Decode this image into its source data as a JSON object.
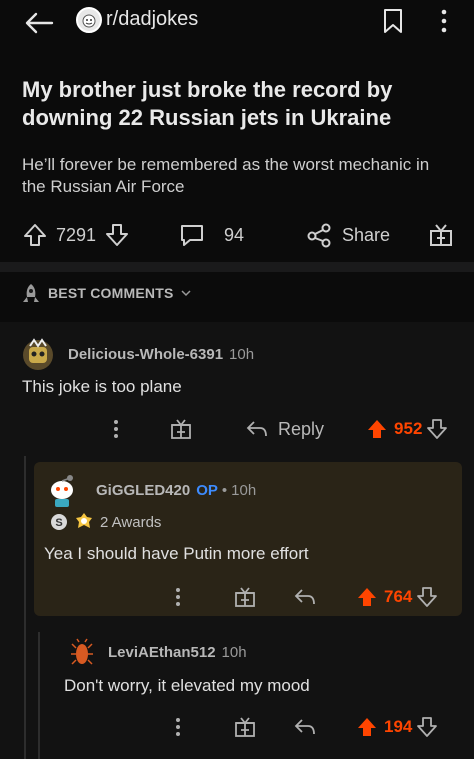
{
  "header": {
    "subreddit": "r/dadjokes",
    "icons": [
      "back-arrow-icon",
      "subreddit-avatar-icon",
      "bookmark-icon",
      "more-vertical-icon"
    ]
  },
  "post": {
    "title": "My brother just broke the record by downing 22 Russian jets in Ukraine",
    "body": "He’ll forever be remembered as the worst mechanic in the Russian Air Force",
    "score": "7291",
    "comments": "94",
    "share_label": "Share"
  },
  "sort": {
    "label": "BEST COMMENTS"
  },
  "colors": {
    "upvote": "#ff4500",
    "op": "#3d8bfd",
    "background": "#0b0b0b",
    "comment_bg": "#121212",
    "highlight_bg": "#2a2417"
  },
  "comments": [
    {
      "author": "Delicious-Whole-6391",
      "age": "10h",
      "text": "This joke is too plane",
      "reply_label": "Reply",
      "score": "952"
    },
    {
      "author": "GiGGLED420",
      "op_label": "OP",
      "separator": "•",
      "age": "10h",
      "awards_label": "2 Awards",
      "text": "Yea I should have Putin more effort",
      "score": "764"
    },
    {
      "author": "LeviAEthan512",
      "age": "10h",
      "text": "Don't worry, it elevated my mood",
      "score": "194"
    }
  ]
}
